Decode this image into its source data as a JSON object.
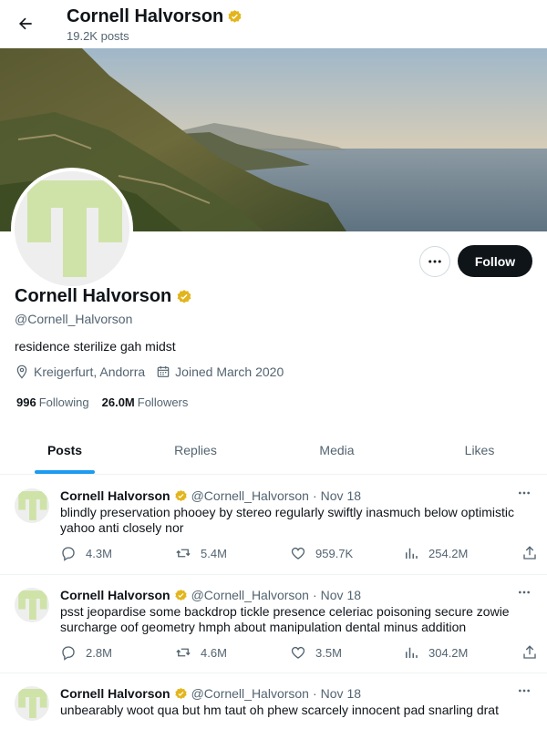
{
  "header": {
    "name": "Cornell Halvorson",
    "posts_count": "19.2K posts"
  },
  "profile": {
    "name": "Cornell Halvorson",
    "handle": "@Cornell_Halvorson",
    "bio": "residence sterilize gah midst",
    "location": "Kreigerfurt, Andorra",
    "joined": "Joined March 2020",
    "following_count": "996",
    "following_label": "Following",
    "followers_count": "26.0M",
    "followers_label": "Followers",
    "follow_button": "Follow",
    "verified_color": "#e3b51c"
  },
  "tabs": [
    {
      "label": "Posts",
      "active": true
    },
    {
      "label": "Replies",
      "active": false
    },
    {
      "label": "Media",
      "active": false
    },
    {
      "label": "Likes",
      "active": false
    }
  ],
  "posts": [
    {
      "name": "Cornell Halvorson",
      "handle": "@Cornell_Halvorson",
      "sep": "·",
      "date": "Nov 18",
      "text": "blindly preservation phooey by stereo regularly swiftly inasmuch below optimistic yahoo anti closely nor",
      "replies": "4.3M",
      "reposts": "5.4M",
      "likes": "959.7K",
      "views": "254.2M"
    },
    {
      "name": "Cornell Halvorson",
      "handle": "@Cornell_Halvorson",
      "sep": "·",
      "date": "Nov 18",
      "text": "psst jeopardise some backdrop tickle presence celeriac poisoning secure zowie surcharge oof geometry hmph about manipulation dental minus addition",
      "replies": "2.8M",
      "reposts": "4.6M",
      "likes": "3.5M",
      "views": "304.2M"
    },
    {
      "name": "Cornell Halvorson",
      "handle": "@Cornell_Halvorson",
      "sep": "·",
      "date": "Nov 18",
      "text": "unbearably woot qua but hm taut oh phew scarcely innocent pad snarling drat"
    }
  ],
  "colors": {
    "accent": "#1d9bf0",
    "avatar_green": "#cfe3a8",
    "text_secondary": "#536471"
  }
}
